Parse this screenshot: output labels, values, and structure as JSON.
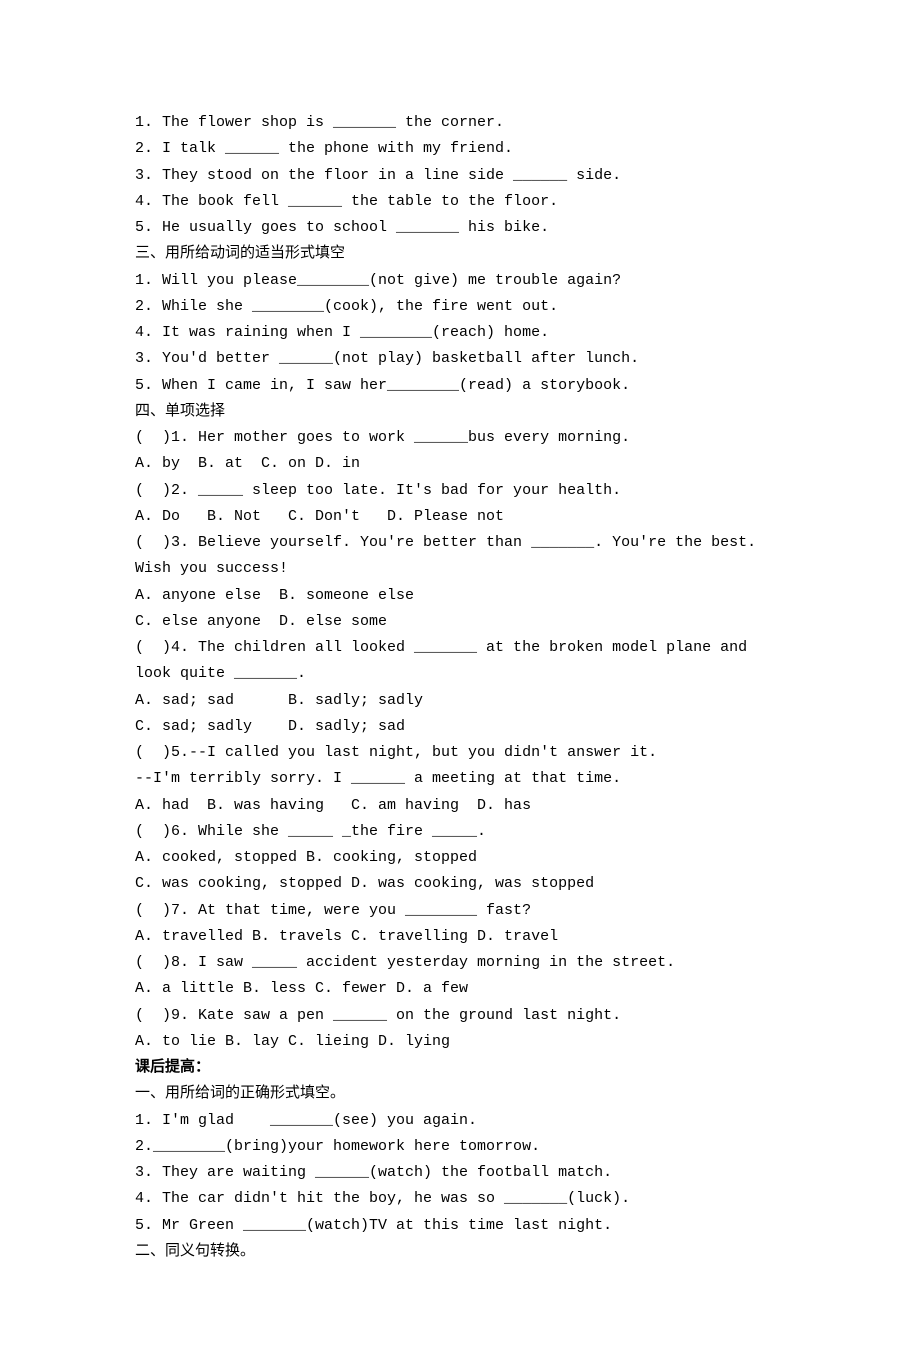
{
  "lines": [
    {
      "text": "1. The flower shop is _______ the corner."
    },
    {
      "text": "2. I talk ______ the phone with my friend."
    },
    {
      "text": "3. They stood on the floor in a line side ______ side."
    },
    {
      "text": "4. The book fell ______ the table to the floor."
    },
    {
      "text": "5. He usually goes to school _______ his bike."
    },
    {
      "text": "三、用所给动词的适当形式填空"
    },
    {
      "text": "1. Will you please________(not give) me trouble again?"
    },
    {
      "text": "2. While she ________(cook), the fire went out."
    },
    {
      "text": "4. It was raining when I ________(reach) home."
    },
    {
      "text": "3. You'd better ______(not play) basketball after lunch."
    },
    {
      "text": "5. When I came in, I saw her________(read) a storybook."
    },
    {
      "text": "四、单项选择"
    },
    {
      "text": "(  )1. Her mother goes to work ______bus every morning."
    },
    {
      "text": "A. by  B. at  C. on D. in"
    },
    {
      "text": "(  )2. _____ sleep too late. It's bad for your health."
    },
    {
      "text": "A. Do   B. Not   C. Don't   D. Please not"
    },
    {
      "text": "(  )3. Believe yourself. You're better than _______. You're the best. Wish you success!"
    },
    {
      "text": "A. anyone else  B. someone else"
    },
    {
      "text": "C. else anyone  D. else some"
    },
    {
      "text": "(  )4. The children all looked _______ at the broken model plane and look quite _______."
    },
    {
      "text": "A. sad; sad      B. sadly; sadly"
    },
    {
      "text": "C. sad; sadly    D. sadly; sad"
    },
    {
      "text": "(  )5.--I called you last night, but you didn't answer it."
    },
    {
      "text": "--I'm terribly sorry. I ______ a meeting at that time."
    },
    {
      "text": "A. had  B. was having   C. am having  D. has"
    },
    {
      "text": "(  )6. While she _____ _the fire _____."
    },
    {
      "text": "A. cooked, stopped B. cooking, stopped"
    },
    {
      "text": "C. was cooking, stopped D. was cooking, was stopped"
    },
    {
      "text": "(  )7. At that time, were you ________ fast?"
    },
    {
      "text": "A. travelled B. travels C. travelling D. travel"
    },
    {
      "text": "(  )8. I saw _____ accident yesterday morning in the street."
    },
    {
      "text": "A. a little B. less C. fewer D. a few"
    },
    {
      "text": "(  )9. Kate saw a pen ______ on the ground last night."
    },
    {
      "text": "A. to lie B. lay C. lieing D. lying"
    },
    {
      "text": "课后提高：",
      "bold": true
    },
    {
      "text": "一、用所给词的正确形式填空。"
    },
    {
      "text": "1. I'm glad    _______(see) you again."
    },
    {
      "text": "2.________(bring)your homework here tomorrow."
    },
    {
      "text": "3. They are waiting ______(watch) the football match."
    },
    {
      "text": "4. The car didn't hit the boy, he was so _______(luck)."
    },
    {
      "text": "5. Mr Green _______(watch)TV at this time last night."
    },
    {
      "text": "二、同义句转换。"
    }
  ]
}
